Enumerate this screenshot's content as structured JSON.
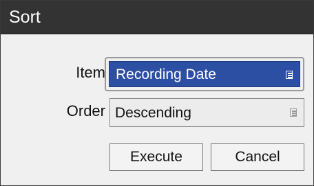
{
  "dialog": {
    "title": "Sort"
  },
  "fields": {
    "item": {
      "label": "Item",
      "value": "Recording Date",
      "icon": "list-icon"
    },
    "order": {
      "label": "Order",
      "value": "Descending",
      "icon": "list-icon"
    }
  },
  "buttons": {
    "execute_label": "Execute",
    "cancel_label": "Cancel"
  },
  "colors": {
    "titlebar": "#333333",
    "selected_field": "#2d4fa3",
    "dialog_background": "#f0f0f0"
  }
}
